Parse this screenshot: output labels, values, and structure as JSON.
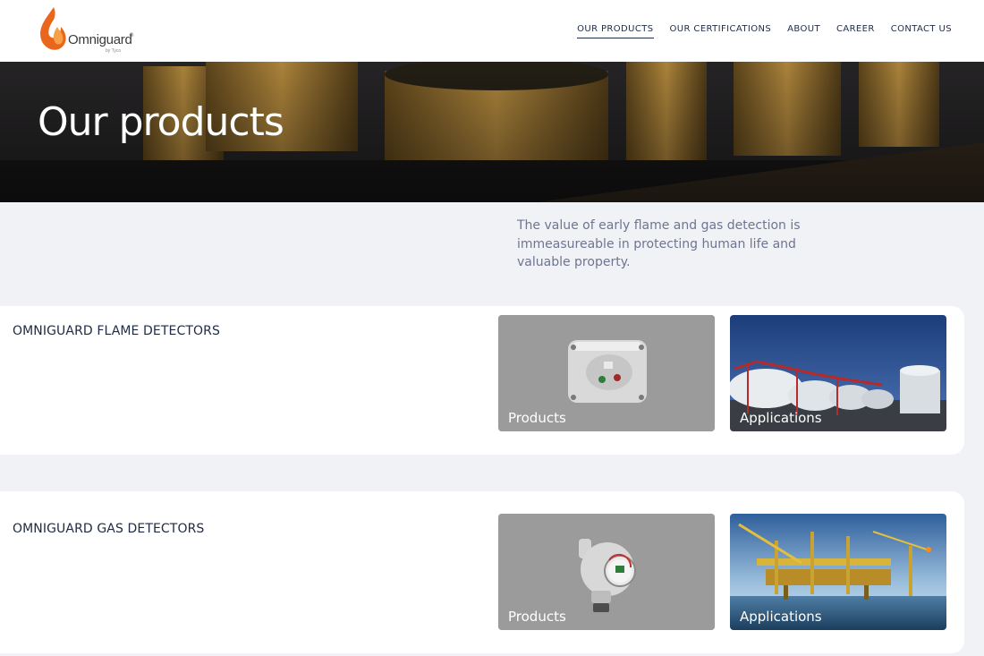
{
  "brand": {
    "name": "Omniguard",
    "registered": "®",
    "tagline": "by Tyco"
  },
  "nav": {
    "items": [
      "OUR PRODUCTS",
      "OUR CERTIFICATIONS",
      "ABOUT",
      "CAREER",
      "CONTACT US"
    ],
    "active": "OUR PRODUCTS"
  },
  "hero": {
    "title": "Our products"
  },
  "intro": {
    "text": "The value of early flame and gas detection is immeasureable in protecting human life and valuable property."
  },
  "categories": [
    {
      "title": "OMNIGUARD FLAME DETECTORS",
      "tiles": [
        "Products",
        "Applications"
      ]
    },
    {
      "title": "OMNIGUARD GAS DETECTORS",
      "tiles": [
        "Products",
        "Applications"
      ]
    }
  ],
  "colors": {
    "brand_orange": "#e8671c",
    "text_dark": "#1f2a44",
    "text_muted": "#6e7591",
    "page_bg": "#f1f2f6"
  }
}
